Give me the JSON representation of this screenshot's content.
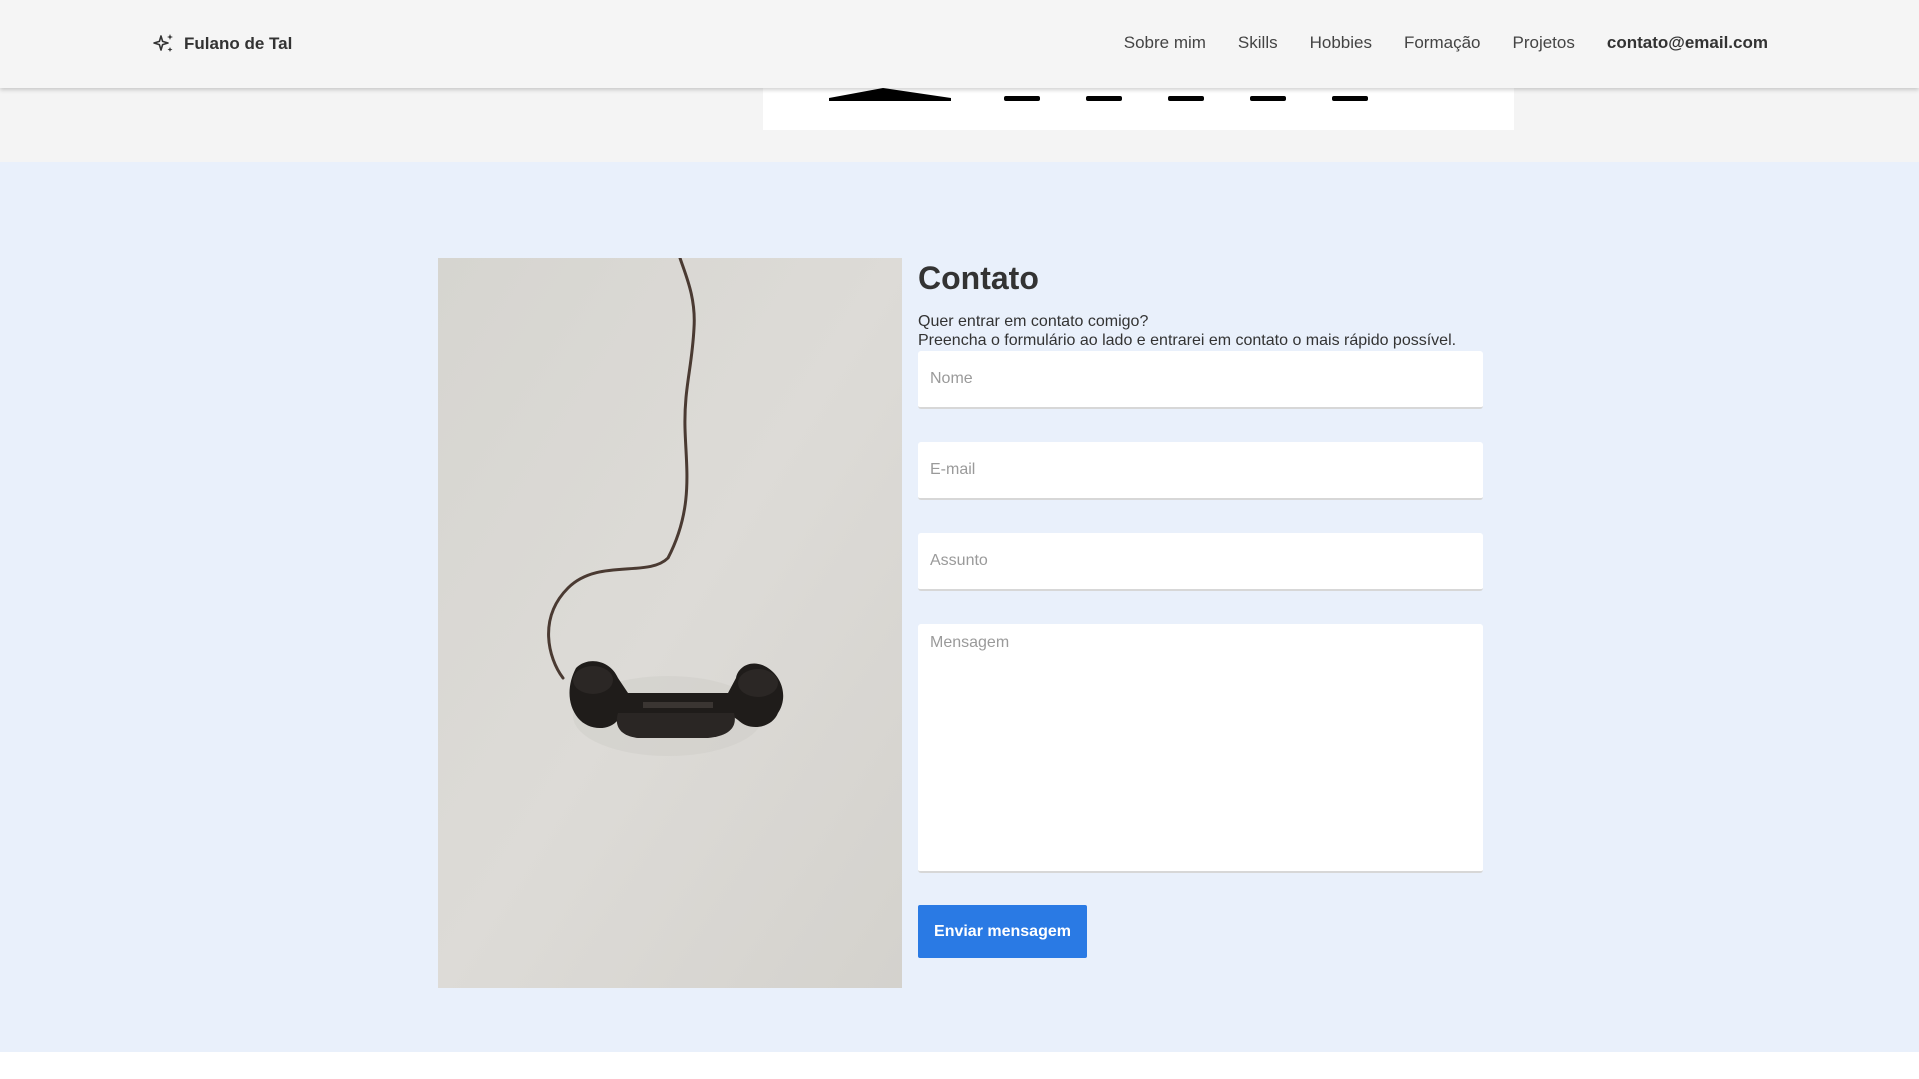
{
  "header": {
    "brand_icon": "sparkles-icon",
    "brand_name": "Fulano de Tal",
    "nav": [
      {
        "label": "Sobre mim"
      },
      {
        "label": "Skills"
      },
      {
        "label": "Hobbies"
      },
      {
        "label": "Formação"
      },
      {
        "label": "Projetos"
      },
      {
        "label": "contato@email.com"
      }
    ]
  },
  "contact": {
    "title": "Contato",
    "subtitle_line1": "Quer entrar em contato comigo?",
    "subtitle_line2": "Preencha o formulário ao lado e entrarei em contato o mais rápido possível.",
    "fields": {
      "name_placeholder": "Nome",
      "email_placeholder": "E-mail",
      "subject_placeholder": "Assunto",
      "message_placeholder": "Mensagem"
    },
    "submit_label": "Enviar mensagem",
    "image": "telephone-receiver-photo"
  },
  "colors": {
    "header_bg": "#f5f5f5",
    "section_bg": "#e9f0fb",
    "accent": "#2a7ae4"
  }
}
